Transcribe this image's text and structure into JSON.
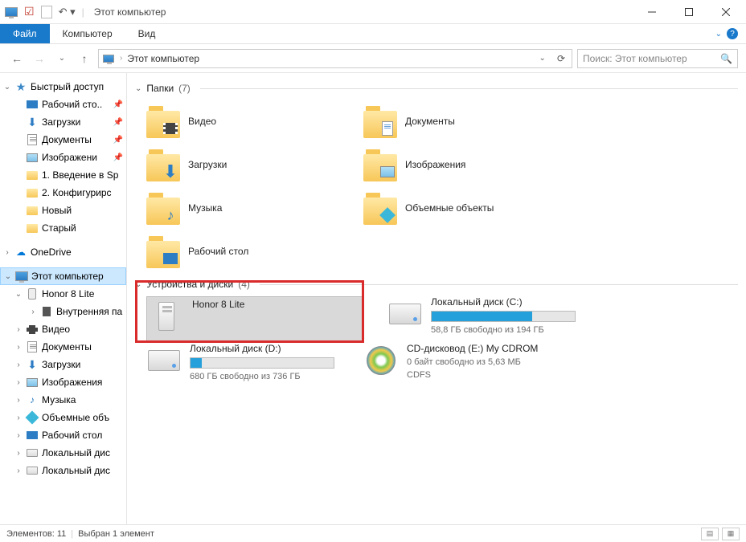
{
  "titlebar": {
    "title": "Этот компьютер"
  },
  "ribbon": {
    "file": "Файл",
    "computer": "Компьютер",
    "view": "Вид"
  },
  "nav": {
    "location": "Этот компьютер",
    "search_placeholder": "Поиск: Этот компьютер"
  },
  "sidebar": {
    "quick_access": "Быстрый доступ",
    "qa_items": [
      {
        "label": "Рабочий сто..",
        "icon": "desktop"
      },
      {
        "label": "Загрузки",
        "icon": "down"
      },
      {
        "label": "Документы",
        "icon": "docs"
      },
      {
        "label": "Изображени",
        "icon": "pic"
      },
      {
        "label": "1. Введение в Sp",
        "icon": "folder"
      },
      {
        "label": "2. Конфигурирс",
        "icon": "folder"
      },
      {
        "label": "Новый",
        "icon": "folder"
      },
      {
        "label": "Старый",
        "icon": "folder"
      }
    ],
    "onedrive": "OneDrive",
    "this_pc": "Этот компьютер",
    "honor": "Honor 8 Lite",
    "internal": "Внутренняя па",
    "lib_video": "Видео",
    "lib_docs": "Документы",
    "lib_downloads": "Загрузки",
    "lib_pics": "Изображения",
    "lib_music": "Музыка",
    "lib_objects": "Объемные объ",
    "lib_desktop": "Рабочий стол",
    "local_disk1": "Локальный дис",
    "local_disk2": "Локальный дис"
  },
  "content": {
    "group_folders": "Папки",
    "folders_count": "(7)",
    "folders": [
      {
        "label": "Видео",
        "ov": "film"
      },
      {
        "label": "Документы",
        "ov": "doc"
      },
      {
        "label": "Загрузки",
        "ov": "arrow"
      },
      {
        "label": "Изображения",
        "ov": "pic"
      },
      {
        "label": "Музыка",
        "ov": "note"
      },
      {
        "label": "Объемные объекты",
        "ov": "cube"
      },
      {
        "label": "Рабочий стол",
        "ov": "screen"
      }
    ],
    "group_drives": "Устройства и диски",
    "drives_count": "(4)",
    "honor": {
      "name": "Honor 8 Lite"
    },
    "drive_c": {
      "name": "Локальный диск (C:)",
      "sub": "58,8 ГБ свободно из 194 ГБ",
      "fill": 70
    },
    "drive_d": {
      "name": "Локальный диск (D:)",
      "sub": "680 ГБ свободно из 736 ГБ",
      "fill": 8
    },
    "cdrom": {
      "name": "CD-дисковод (E:) My CDROM",
      "sub1": "0 байт свободно из 5,63 МБ",
      "sub2": "CDFS"
    }
  },
  "status": {
    "items": "Элементов: 11",
    "selected": "Выбран 1 элемент"
  }
}
